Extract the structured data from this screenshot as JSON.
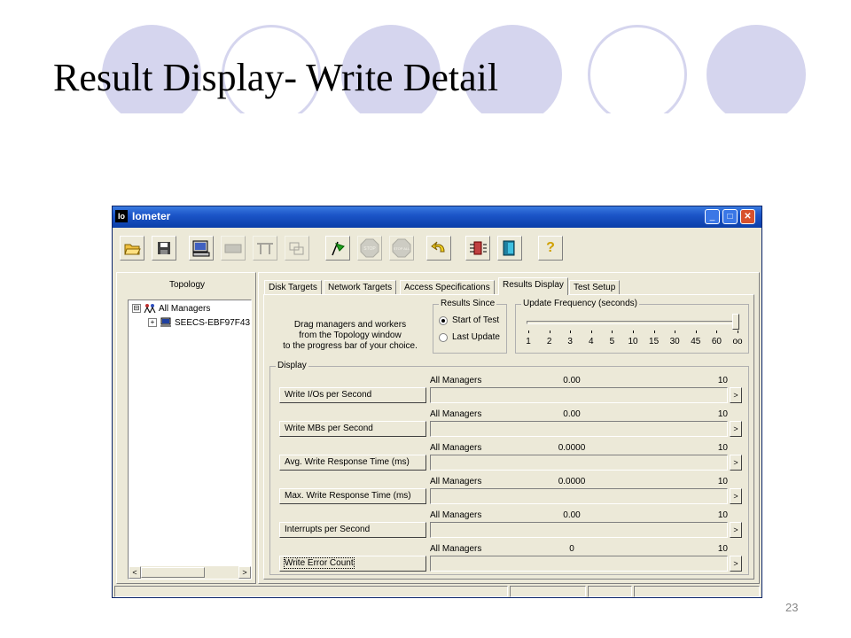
{
  "slide": {
    "title": "Result Display- Write Detail",
    "page_number": "23",
    "colors": {
      "circle": "#d5d5ee"
    }
  },
  "window": {
    "app_icon_text": "Io",
    "title": "Iometer",
    "controls": {
      "minimize": "_",
      "maximize": "□",
      "close": "✕"
    },
    "colors": {
      "titlebar": "#0a3ea8",
      "face": "#ece9d8"
    }
  },
  "toolbar": {
    "buttons": [
      {
        "name": "open-icon"
      },
      {
        "name": "save-icon"
      },
      {
        "name": "new-disk-worker-icon"
      },
      {
        "name": "new-network-worker-icon"
      },
      {
        "name": "duplicate-worker-icon"
      },
      {
        "name": "disconnect-icon"
      },
      {
        "name": "start-flag-icon"
      },
      {
        "name": "stop-icon",
        "text": "STOP"
      },
      {
        "name": "stop-all-icon",
        "text": "STOP ALL"
      },
      {
        "name": "reset-workers-icon"
      },
      {
        "name": "exit-icon"
      },
      {
        "name": "quit-icon"
      },
      {
        "name": "help-icon",
        "text": "?"
      }
    ]
  },
  "topology": {
    "label": "Topology",
    "tree": [
      {
        "toggle": "⊟",
        "label": "All Managers"
      },
      {
        "toggle": "+",
        "label": "SEECS-EBF97F43"
      }
    ],
    "scroll_left": "<",
    "scroll_right": ">"
  },
  "tabs": [
    {
      "label": "Disk Targets",
      "active": false
    },
    {
      "label": "Network Targets",
      "active": false
    },
    {
      "label": "Access Specifications",
      "active": false
    },
    {
      "label": "Results Display",
      "active": true
    },
    {
      "label": "Test Setup",
      "active": false
    }
  ],
  "instructions": [
    "Drag managers and workers",
    "from the Topology window",
    "to the progress bar of your choice."
  ],
  "results_since": {
    "legend": "Results Since",
    "options": [
      {
        "label": "Start of Test",
        "selected": true
      },
      {
        "label": "Last Update",
        "selected": false
      }
    ]
  },
  "update_frequency": {
    "legend": "Update Frequency (seconds)",
    "ticks": [
      "1",
      "2",
      "3",
      "4",
      "5",
      "10",
      "15",
      "30",
      "45",
      "60",
      "oo"
    ],
    "selected": "oo"
  },
  "display": {
    "legend": "Display",
    "rows": [
      {
        "button": "Write I/Os per Second",
        "target": "All Managers",
        "value": "0.00",
        "max": "10",
        "arrow": ">"
      },
      {
        "button": "Write MBs per Second",
        "target": "All Managers",
        "value": "0.00",
        "max": "10",
        "arrow": ">"
      },
      {
        "button": "Avg. Write Response Time (ms)",
        "target": "All Managers",
        "value": "0.0000",
        "max": "10",
        "arrow": ">"
      },
      {
        "button": "Max. Write Response Time (ms)",
        "target": "All Managers",
        "value": "0.0000",
        "max": "10",
        "arrow": ">"
      },
      {
        "button": "Interrupts per Second",
        "target": "All Managers",
        "value": "0.00",
        "max": "10",
        "arrow": ">"
      },
      {
        "button": "Write Error Count",
        "target": "All Managers",
        "value": "0",
        "max": "10",
        "arrow": ">"
      }
    ]
  }
}
